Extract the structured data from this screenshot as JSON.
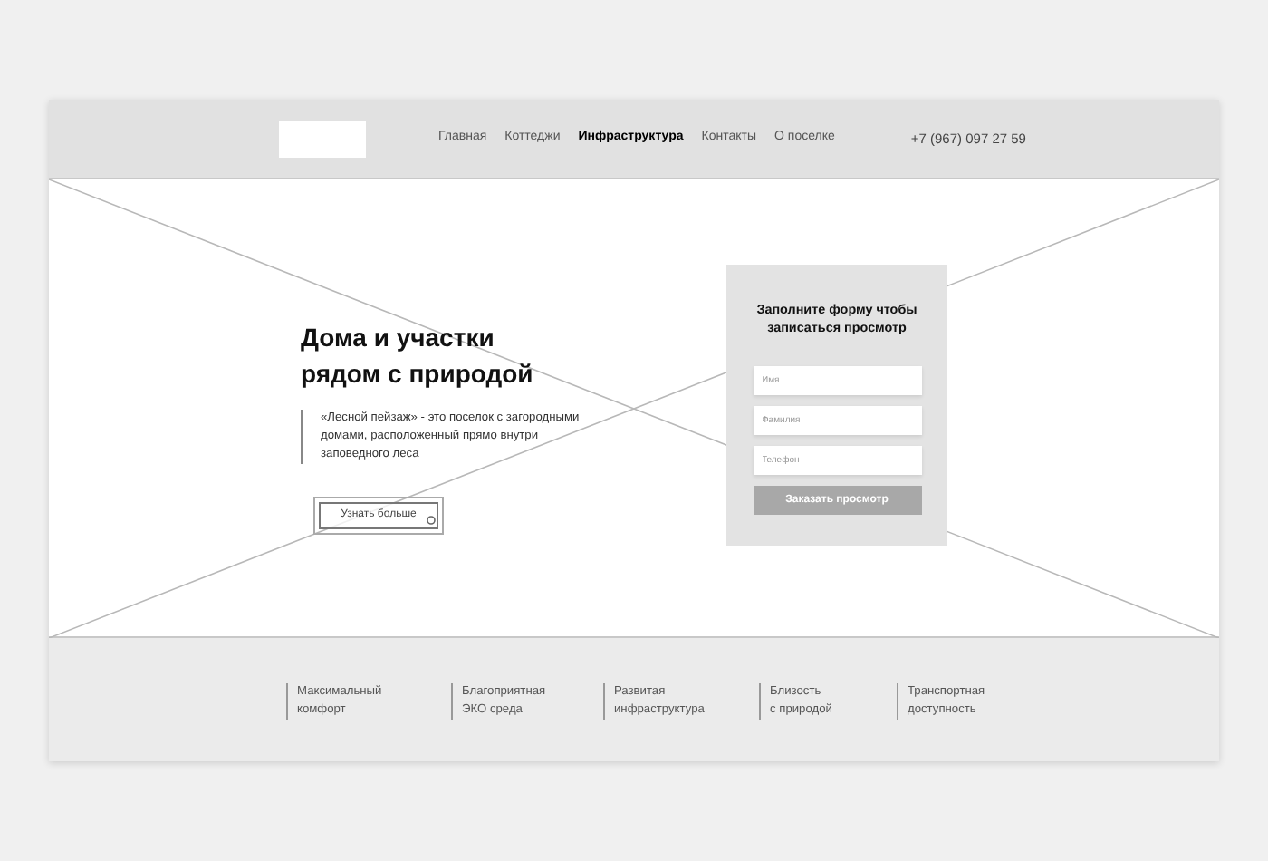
{
  "header": {
    "nav": [
      {
        "label": "Главная",
        "selected": false
      },
      {
        "label": "Коттеджи",
        "selected": false
      },
      {
        "label": "Инфраструктура",
        "selected": true
      },
      {
        "label": "Контакты",
        "selected": false
      },
      {
        "label": "О поселке",
        "selected": false
      }
    ],
    "phone": "+7 (967) 097 27 59"
  },
  "hero": {
    "title_lines": [
      "Дома и участки",
      "рядом с природой"
    ],
    "description": "«Лесной пейзаж» - это поселок с загородными домами, расположенный прямо внутри заповедного леса",
    "button": "Узнать больше"
  },
  "form": {
    "title": "Заполните форму чтобы записаться просмотр",
    "fields": [
      {
        "placeholder": "Имя"
      },
      {
        "placeholder": "Фамилия"
      },
      {
        "placeholder": "Телефон"
      }
    ],
    "submit": "Заказать просмотр"
  },
  "features": [
    [
      "Максимальный",
      "комфорт"
    ],
    [
      "Благоприятная",
      "ЭКО среда"
    ],
    [
      "Развитая",
      "инфраструктура"
    ],
    [
      "Близость",
      "с природой"
    ],
    [
      "Транспортная",
      "доступность"
    ]
  ]
}
